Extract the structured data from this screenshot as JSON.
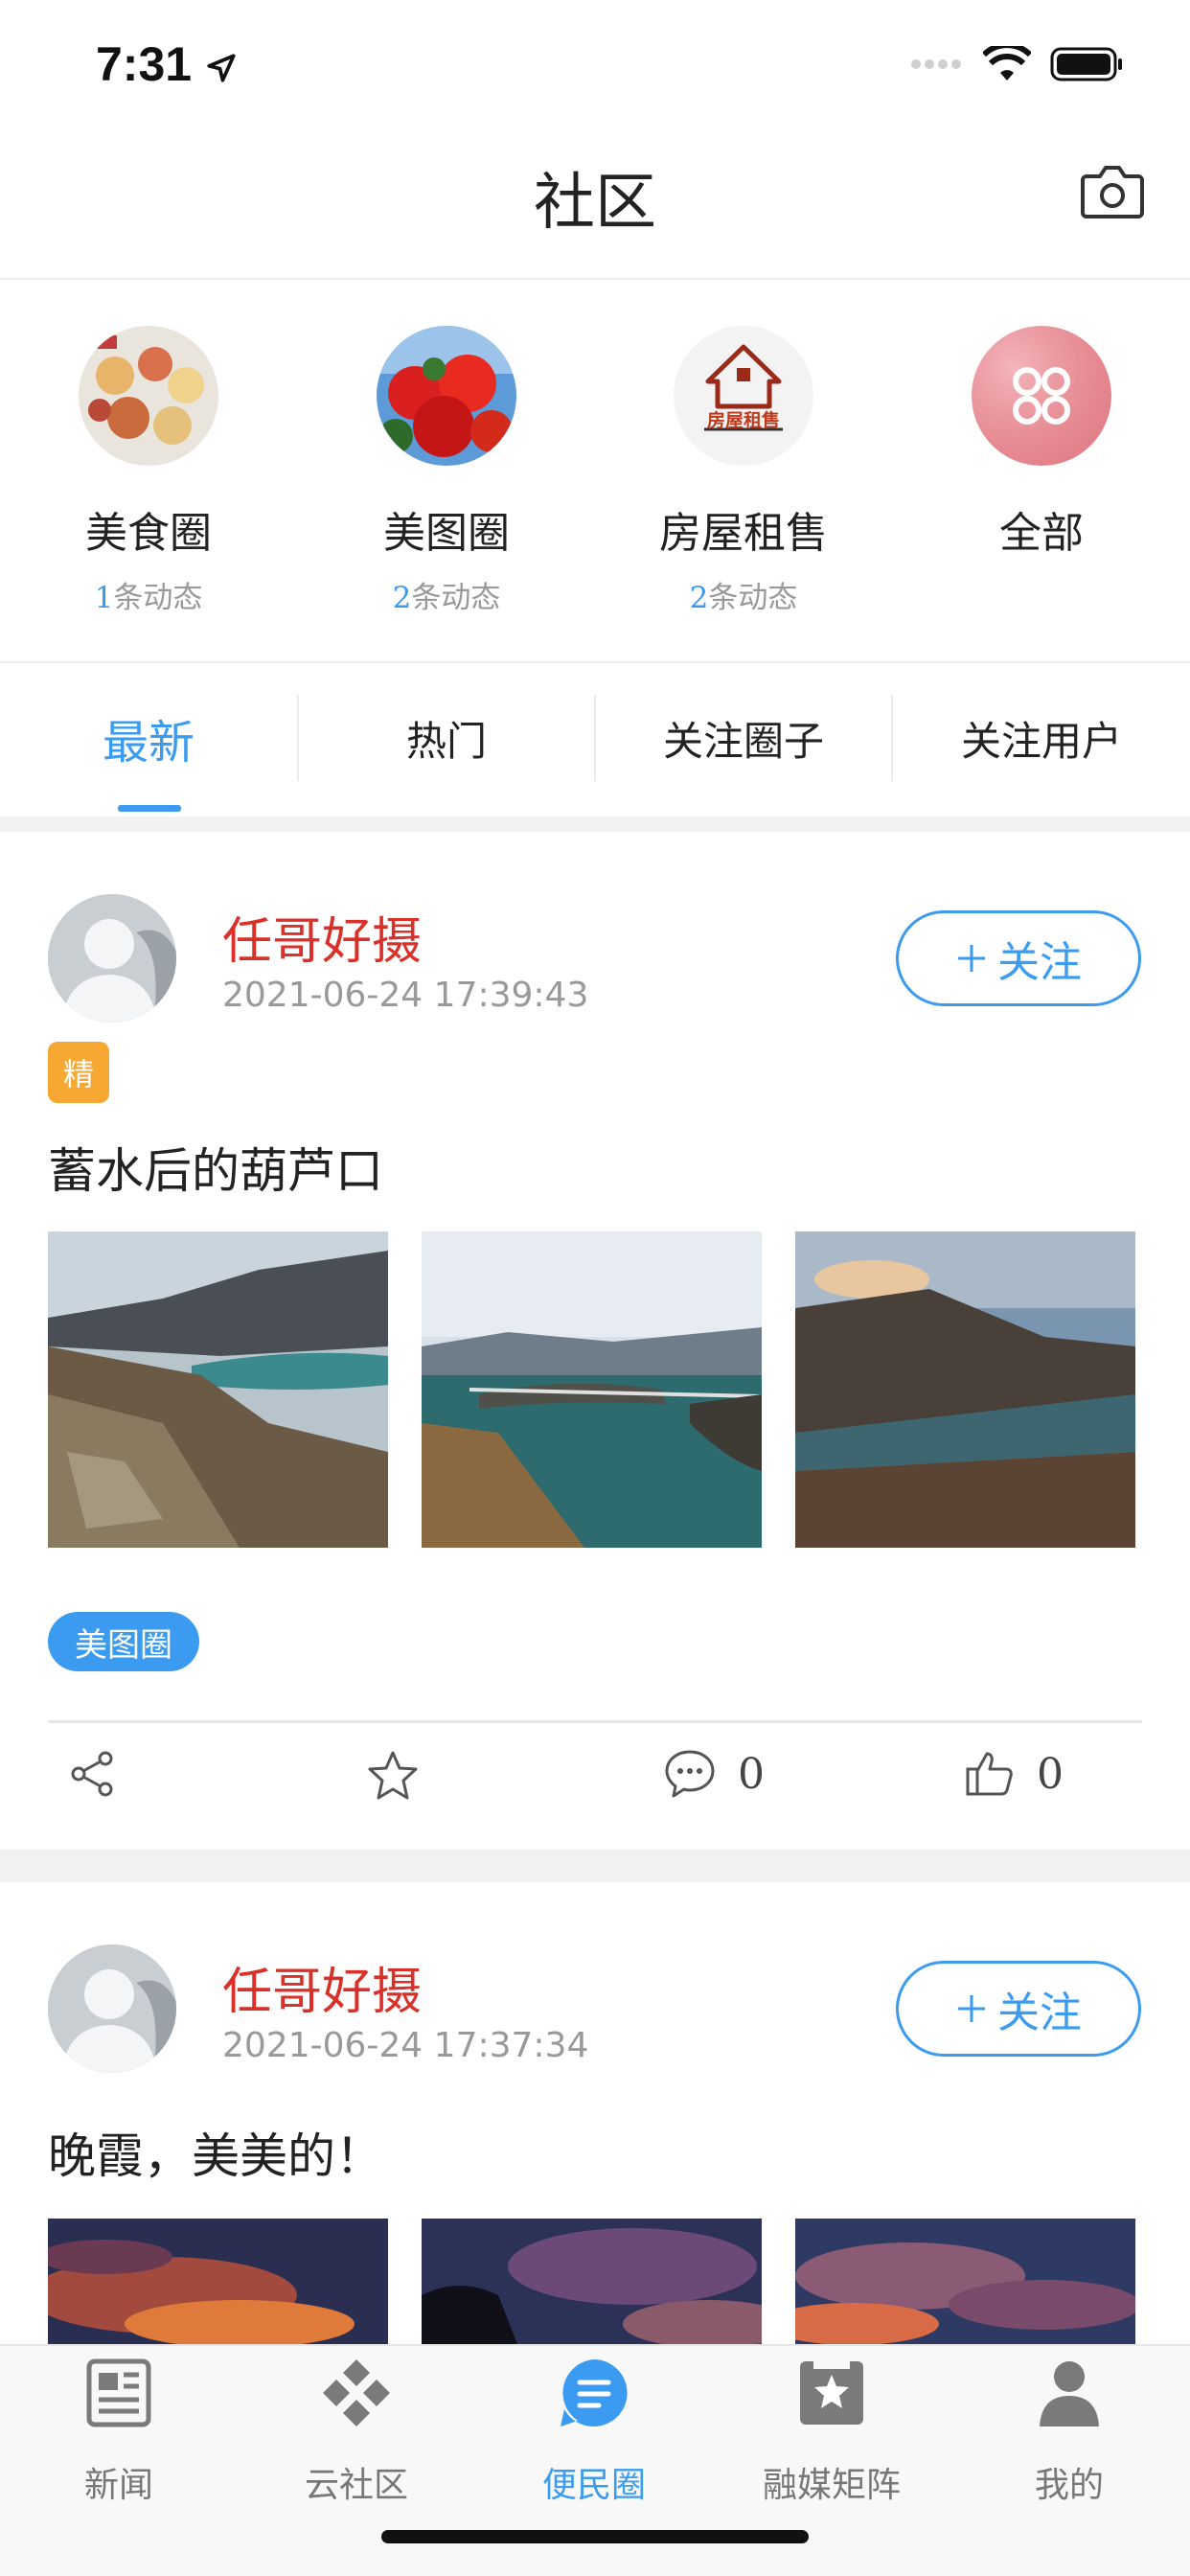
{
  "status_bar": {
    "time": "7:31"
  },
  "header": {
    "title": "社区"
  },
  "circles": [
    {
      "name": "美食圈",
      "count": "1",
      "count_suffix": "条动态"
    },
    {
      "name": "美图圈",
      "count": "2",
      "count_suffix": "条动态"
    },
    {
      "name": "房屋租售",
      "count": "2",
      "count_suffix": "条动态",
      "logo_text": "房屋租售"
    },
    {
      "name": "全部"
    }
  ],
  "tabs": [
    {
      "label": "最新",
      "active": true
    },
    {
      "label": "热门"
    },
    {
      "label": "关注圈子"
    },
    {
      "label": "关注用户"
    }
  ],
  "posts": [
    {
      "author": "任哥好摄",
      "time": "2021-06-24 17:39:43",
      "follow_label": "关注",
      "badge": "精",
      "text": "蓄水后的葫芦口",
      "tag": "美图圈",
      "comments": "0",
      "likes": "0"
    },
    {
      "author": "任哥好摄",
      "time": "2021-06-24 17:37:34",
      "follow_label": "关注",
      "text": "晚霞，美美的！"
    }
  ],
  "bottom_nav": [
    {
      "label": "新闻",
      "icon": "news-icon"
    },
    {
      "label": "云社区",
      "icon": "cloud-community-icon"
    },
    {
      "label": "便民圈",
      "icon": "service-circle-icon",
      "active": true
    },
    {
      "label": "融媒矩阵",
      "icon": "media-matrix-icon"
    },
    {
      "label": "我的",
      "icon": "profile-icon"
    }
  ],
  "colors": {
    "accent": "#3a9bf0",
    "author": "#d9312a",
    "badge": "#f7a832"
  }
}
